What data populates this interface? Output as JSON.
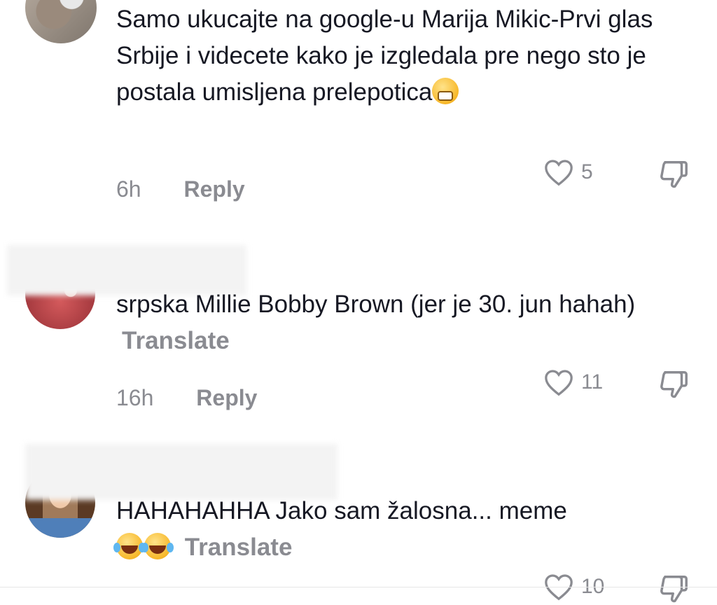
{
  "comments": [
    {
      "text": "Samo ukucajte na google-u Marija Mikic-Prvi glas Srbije i videcete kako je izgledala pre nego sto je postala umisljena prelepotica",
      "emoji": "grinning-face-icon",
      "time": "6h",
      "reply_label": "Reply",
      "likes": "5"
    },
    {
      "text": "srpska Millie Bobby Brown (jer je 30. jun hahah)",
      "translate_label": "Translate",
      "time": "16h",
      "reply_label": "Reply",
      "likes": "11"
    },
    {
      "text": "HAHAHAHHA Jako sam žalosna... meme",
      "emoji": "face-with-tears-of-joy-icon",
      "translate_label": "Translate",
      "likes": "10"
    }
  ],
  "colors": {
    "text": "#161823",
    "secondary": "#8a8b91"
  }
}
